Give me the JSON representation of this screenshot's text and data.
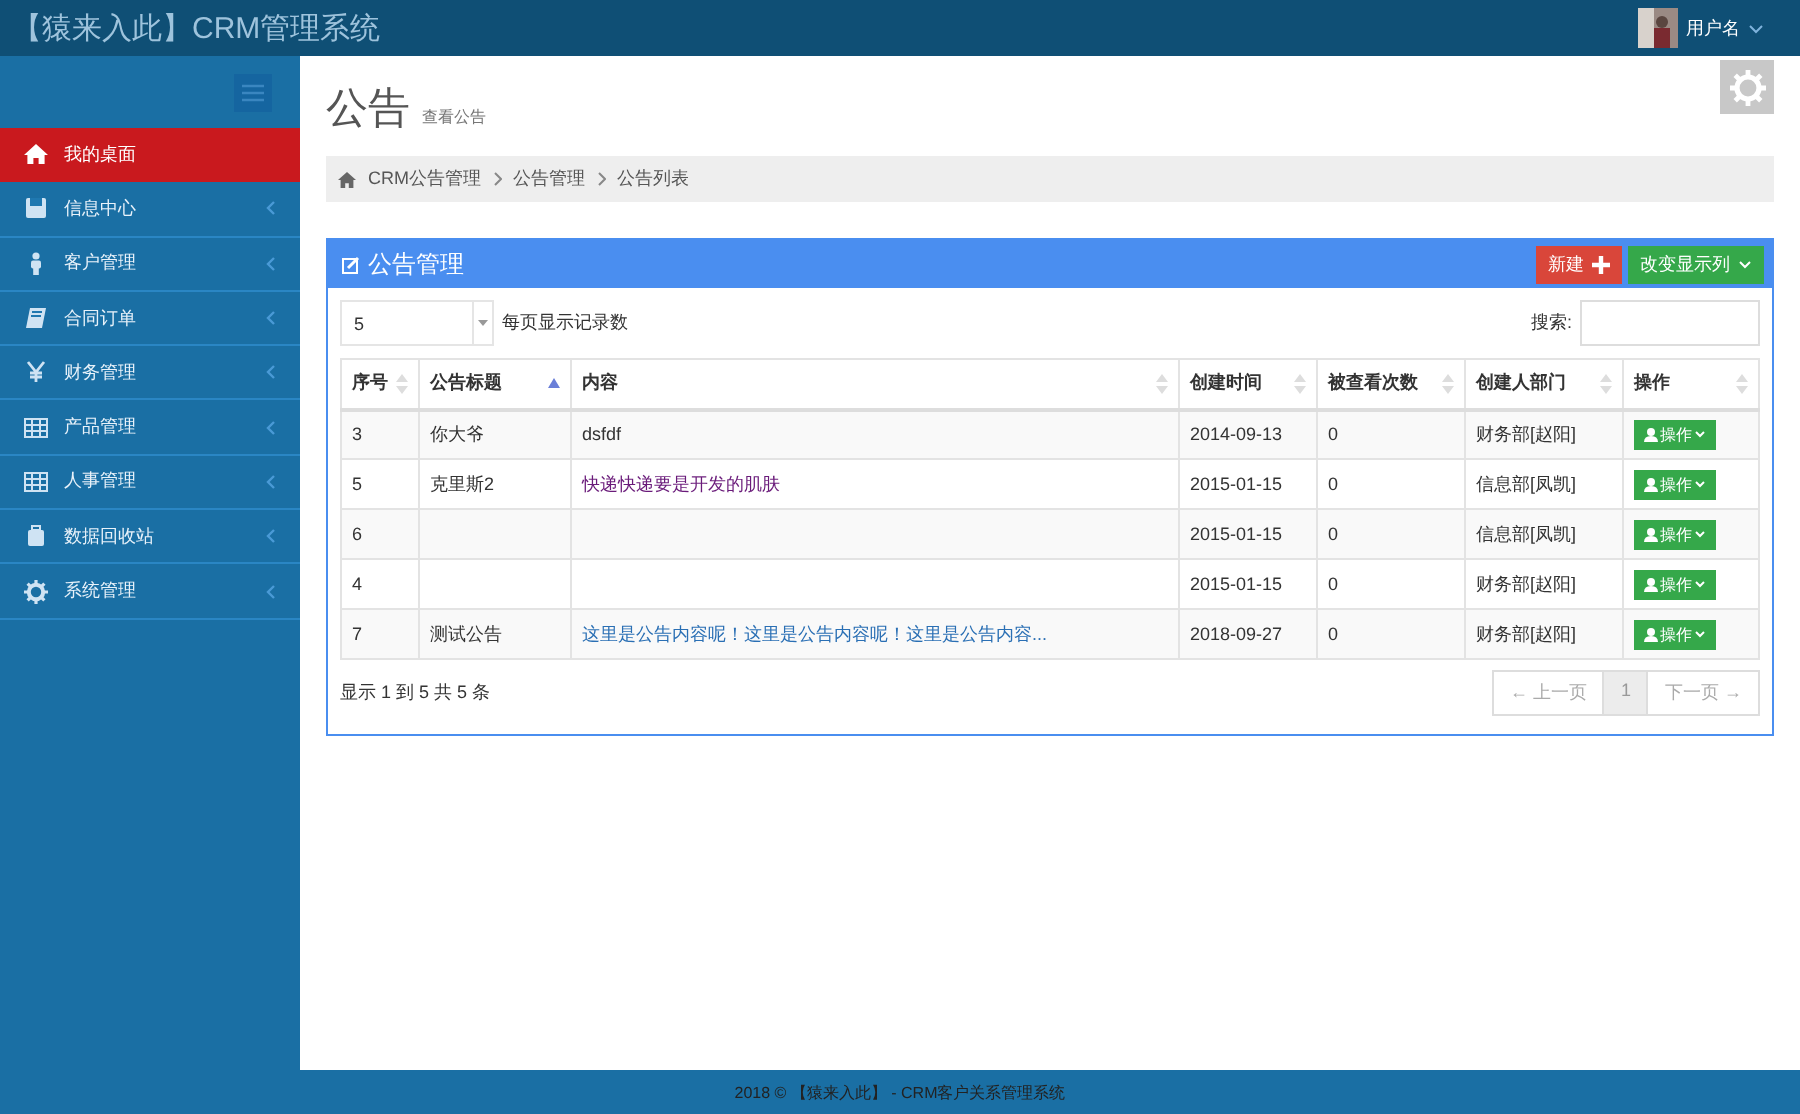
{
  "header": {
    "brand": "【猿来入此】CRM管理系统",
    "user": "用户名"
  },
  "sidebar": {
    "items": [
      {
        "label": "我的桌面",
        "kind": "home",
        "selected": true
      },
      {
        "label": "信息中心",
        "kind": "disk",
        "selected": false
      },
      {
        "label": "客户管理",
        "kind": "person",
        "selected": false
      },
      {
        "label": "合同订单",
        "kind": "book",
        "selected": false
      },
      {
        "label": "财务管理",
        "kind": "yen",
        "selected": false
      },
      {
        "label": "产品管理",
        "kind": "table",
        "selected": false
      },
      {
        "label": "人事管理",
        "kind": "table",
        "selected": false
      },
      {
        "label": "数据回收站",
        "kind": "bin",
        "selected": false
      },
      {
        "label": "系统管理",
        "kind": "gear",
        "selected": false
      }
    ]
  },
  "page": {
    "title": "公告",
    "subtitle": "查看公告"
  },
  "breadcrumb": [
    "CRM公告管理",
    "公告管理",
    "公告列表"
  ],
  "panel": {
    "title": "公告管理",
    "buttons": [
      {
        "label": "新建",
        "kind": "new"
      },
      {
        "label": "改变显示列",
        "kind": "columns"
      }
    ],
    "page_size": "5",
    "page_size_label": "每页显示记录数",
    "search_label": "搜索:",
    "table": {
      "columns": [
        {
          "label": "序号",
          "sorted": false
        },
        {
          "label": "公告标题",
          "sorted": true
        },
        {
          "label": "内容",
          "sorted": false
        },
        {
          "label": "创建时间",
          "sorted": false
        },
        {
          "label": "被查看次数",
          "sorted": false
        },
        {
          "label": "创建人部门",
          "sorted": false
        },
        {
          "label": "操作",
          "sorted": false
        }
      ],
      "rows": [
        {
          "id": "3",
          "title": "你大爷",
          "content": "dsfdf",
          "content_link": false,
          "content_visited": false,
          "date": "2014-09-13",
          "views": "0",
          "dept": "财务部[赵阳]",
          "action": "操作"
        },
        {
          "id": "5",
          "title": "克里斯2",
          "content": "快递快递要是开发的肌肤",
          "content_link": true,
          "content_visited": true,
          "date": "2015-01-15",
          "views": "0",
          "dept": "信息部[凤凯]",
          "action": "操作"
        },
        {
          "id": "6",
          "date": "2015-01-15",
          "views": "0",
          "dept": "信息部[凤凯]",
          "action": "操作"
        },
        {
          "id": "4",
          "date": "2015-01-15",
          "views": "0",
          "dept": "财务部[赵阳]",
          "action": "操作"
        },
        {
          "id": "7",
          "title": "测试公告",
          "content": "这里是公告内容呢！这里是公告内容呢！这里是公告内容...",
          "content_link": true,
          "content_visited": false,
          "date": "2018-09-27",
          "views": "0",
          "dept": "财务部[赵阳]",
          "action": "操作"
        }
      ]
    },
    "info": "显示 1 到 5 共 5 条",
    "pagination": [
      {
        "label": "← 上一页",
        "disabled": true,
        "selected": false
      },
      {
        "label": "1",
        "disabled": false,
        "selected": true
      },
      {
        "label": "下一页 →",
        "disabled": true,
        "selected": false
      }
    ]
  },
  "footer": "2018 © 【猿来入此】 - CRM客户关系管理系统"
}
